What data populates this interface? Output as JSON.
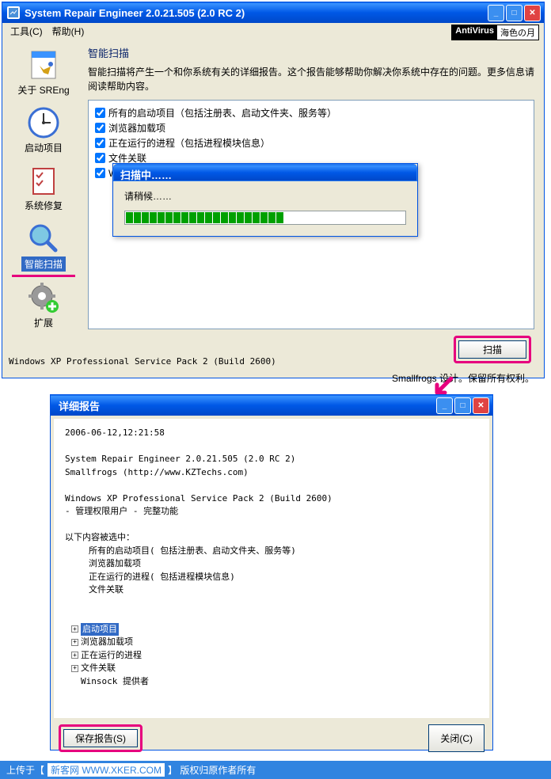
{
  "window1": {
    "title": "System Repair Engineer 2.0.21.505 (2.0 RC 2)",
    "menu": {
      "tools": "工具(C)",
      "help": "帮助(H)"
    },
    "badge": {
      "av": "AntiVirus",
      "jp": "海色の月"
    },
    "sidebar": {
      "items": [
        {
          "label": "关于 SREng"
        },
        {
          "label": "启动项目"
        },
        {
          "label": "系统修复"
        },
        {
          "label": "智能扫描"
        },
        {
          "label": "扩展"
        }
      ]
    },
    "content": {
      "title": "智能扫描",
      "desc": "智能扫描将产生一个和你系统有关的详细报告。这个报告能够帮助你解决你系统中存在的问题。更多信息请阅读帮助内容。",
      "checks": [
        "所有的启动项目（包括注册表、启动文件夹、服务等）",
        "浏览器加载项",
        "正在运行的进程（包括进程模块信息）",
        "文件关联",
        "Winsock 提供者"
      ],
      "scan_btn": "扫描"
    },
    "progress": {
      "title": "扫描中……",
      "wait": "请稍候……"
    },
    "status": "Windows XP Professional Service Pack 2 (Build 2600)",
    "copyright": "Smallfrogs 设计。保留所有权利。"
  },
  "window2": {
    "title": "详细报告",
    "body": {
      "timestamp": "2006-06-12,12:21:58",
      "product": "System Repair Engineer 2.0.21.505 (2.0 RC 2)",
      "author": "Smallfrogs (http://www.KZTechs.com)",
      "os": "Windows XP Professional Service Pack 2 (Build 2600)",
      "priv": "- 管理权限用户 - 完整功能",
      "seltitle": "以下内容被选中：",
      "sel": [
        "所有的启动项目( 包括注册表、启动文件夹、服务等)",
        "浏览器加载项",
        "正在运行的进程( 包括进程模块信息)",
        "文件关联"
      ],
      "tree": [
        "启动项目",
        "浏览器加载项",
        "正在运行的进程",
        "文件关联",
        "Winsock 提供者"
      ]
    },
    "buttons": {
      "save": "保存报告(S)",
      "close": "关闭(C)"
    }
  },
  "footer": {
    "prefix": "上传于【",
    "site": "新客网 WWW.XKER.COM",
    "suffix": "】 版权归原作者所有"
  }
}
